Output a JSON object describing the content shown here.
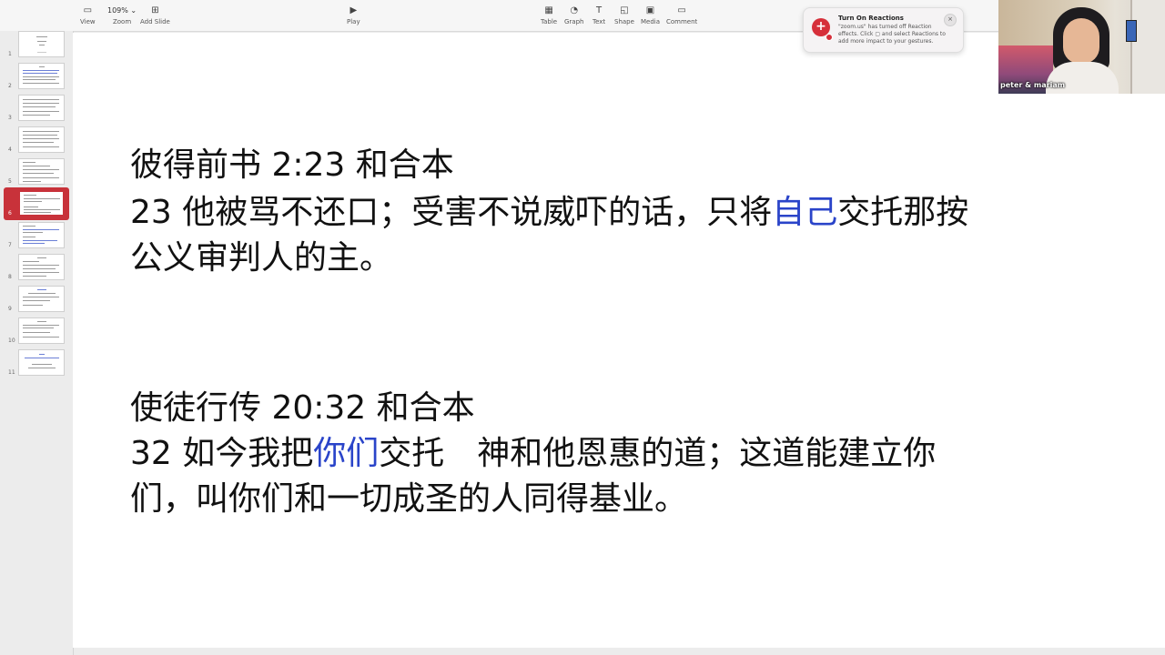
{
  "toolbar": {
    "view_label": "View",
    "zoom_value": "109% ⌄",
    "zoom_label": "Zoom",
    "add_slide_label": "Add Slide",
    "play_label": "Play",
    "table_label": "Table",
    "graph_label": "Graph",
    "text_label": "Text",
    "shape_label": "Shape",
    "media_label": "Media",
    "comment_label": "Comment"
  },
  "slides": {
    "numbers": [
      "1",
      "2",
      "3",
      "4",
      "5",
      "6",
      "7",
      "8",
      "9",
      "10",
      "11"
    ],
    "selected_index": 6
  },
  "slide": {
    "verse1_ref": "彼得前书 2:23 和合本",
    "verse1_l1_a": "23 他被骂不还口；受害不说威吓的话，只将",
    "verse1_l1_hl": "自己",
    "verse1_l1_b": "交托那按",
    "verse1_l2": "公义审判人的主。",
    "verse2_ref": "使徒行传 20:32 和合本",
    "verse2_l1_a": "32 如今我把",
    "verse2_l1_hl": "你们",
    "verse2_l1_b": "交托　神和他恩惠的道；这道能建立你",
    "verse2_l2": "们，叫你们和一切成圣的人同得基业。",
    "highlight_color": "#2a44c9"
  },
  "toast": {
    "title": "Turn On Reactions",
    "body": "\"zoom.us\" has turned off Reaction effects. Click ▢ and select Reactions to add more impact to your gestures.",
    "close_glyph": "×",
    "badge_glyph": "+"
  },
  "video": {
    "participant_name": "peter & mariam"
  }
}
